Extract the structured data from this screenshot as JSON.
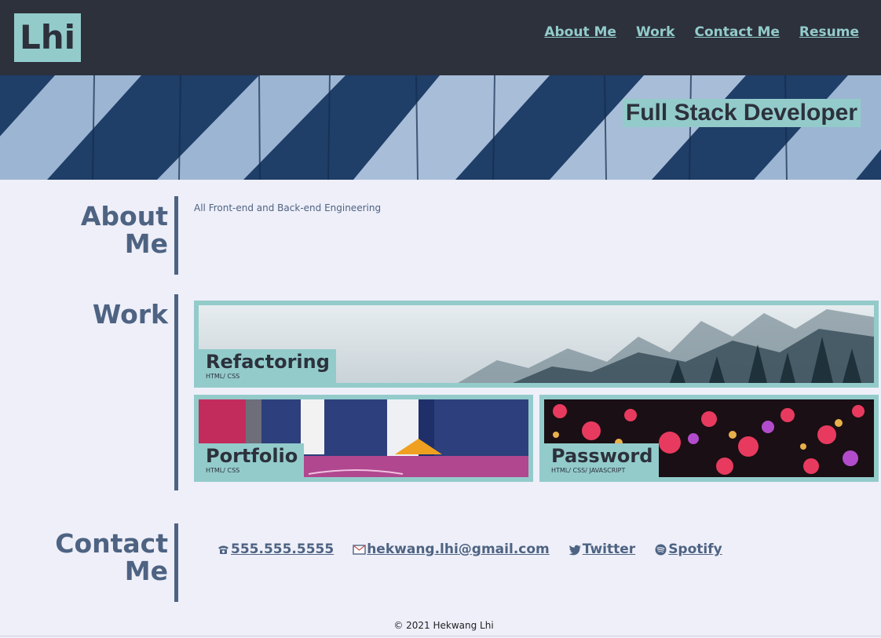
{
  "header": {
    "logo": "Lhi",
    "nav": [
      "About Me",
      "Work",
      "Contact Me",
      "Resume"
    ]
  },
  "hero": {
    "title": "Full Stack Developer"
  },
  "about": {
    "heading_line1": "About",
    "heading_line2": "Me",
    "text": "All Front-end and Back-end Engineering"
  },
  "work": {
    "heading": "Work",
    "projects": [
      {
        "name": "Refactoring",
        "tech": "HTML/ CSS"
      },
      {
        "name": "Portfolio",
        "tech": "HTML/ CSS"
      },
      {
        "name": "Password",
        "tech": "HTML/ CSS/ JAVASCRIPT"
      }
    ]
  },
  "contact": {
    "heading_line1": "Contact",
    "heading_line2": "Me",
    "phone": "555.555.5555",
    "email": "hekwang.lhi@gmail.com",
    "twitter": "Twitter",
    "spotify": "Spotify"
  },
  "footer": {
    "text": "© 2021 Hekwang Lhi"
  },
  "colors": {
    "dark": "#2c313c",
    "accent": "#93cbcb",
    "slate": "#4e6382",
    "background": "#eeeff9"
  }
}
